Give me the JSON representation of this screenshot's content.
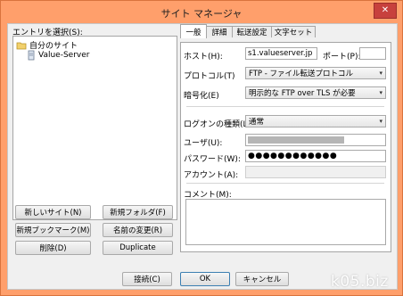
{
  "window": {
    "title": "サイト マネージャ",
    "close_glyph": "✕"
  },
  "entries": {
    "label": "エントリを選択(S):",
    "tree": [
      {
        "label": "自分のサイト",
        "icon": "folder-icon"
      },
      {
        "label": "Value-Server",
        "icon": "server-icon"
      }
    ]
  },
  "left_buttons": {
    "new_site": "新しいサイト(N)",
    "new_folder": "新規フォルダ(F)",
    "new_bookmark": "新規ブックマーク(M)",
    "rename": "名前の変更(R)",
    "delete": "削除(D)",
    "duplicate": "Duplicate"
  },
  "tabs": [
    "一般",
    "詳細",
    "転送設定",
    "文字セット"
  ],
  "general": {
    "host_label": "ホスト(H):",
    "host_value": "s1.valueserver.jp",
    "port_label": "ポート(P):",
    "port_value": "",
    "protocol_label": "プロトコル(T)",
    "protocol_value": "FTP - ファイル転送プロトコル",
    "encryption_label": "暗号化(E)",
    "encryption_value": "明示的な FTP over TLS が必要",
    "logon_label": "ログオンの種類(L):",
    "logon_value": "通常",
    "user_label": "ユーザ(U):",
    "user_value": "",
    "password_label": "パスワード(W):",
    "password_value": "●●●●●●●●●●●●",
    "account_label": "アカウント(A):",
    "account_value": "",
    "comment_label": "コメント(M):",
    "comment_value": ""
  },
  "bottom_buttons": {
    "connect": "接続(C)",
    "ok": "OK",
    "cancel": "キャンセル"
  },
  "watermark": "k05.biz",
  "colors": {
    "frame": "#ff9f6b",
    "close": "#c7413d",
    "client": "#f0f0f0",
    "user_redaction": "#b5b5b5"
  }
}
